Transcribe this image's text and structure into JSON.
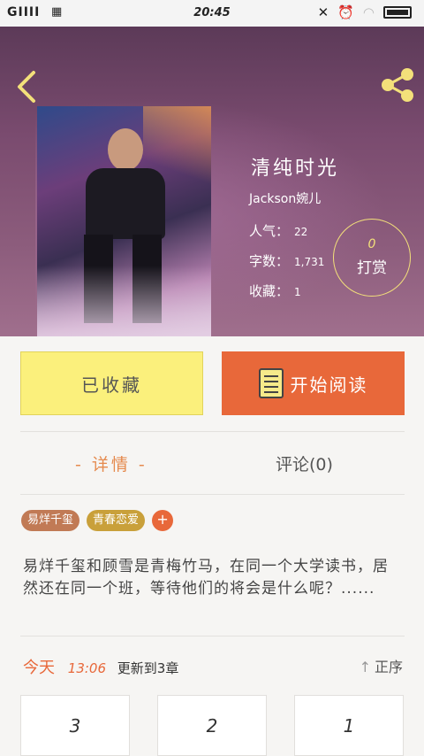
{
  "status_bar": {
    "signal": "GIIII",
    "time": "20:45"
  },
  "book": {
    "title": "清纯时光",
    "author": "Jackson婉儿",
    "stats": [
      {
        "label": "人气：",
        "value": "22"
      },
      {
        "label": "字数：",
        "value": "1,731"
      },
      {
        "label": "收藏：",
        "value": "1"
      }
    ],
    "tip": {
      "count": "0",
      "label": "打赏"
    }
  },
  "actions": {
    "favorite_label": "已收藏",
    "read_label": "开始阅读"
  },
  "tabs": {
    "detail": "- 详情 -",
    "comment": "评论(0)"
  },
  "tags": [
    "易烊千玺",
    "青春恋爱"
  ],
  "tag_add": "+",
  "description": "易烊千玺和顾雪是青梅竹马，在同一个大学读书，居然还在同一个班，等待他们的将会是什么呢？......",
  "update": {
    "today": "今天",
    "time": "13:06",
    "text": "更新到3章",
    "sort_label": "正序"
  },
  "chapters": [
    "3",
    "2",
    "1"
  ],
  "colors": {
    "accent_orange": "#e8683a",
    "accent_yellow": "#fbf07c",
    "icon_yellow": "#f3e07a"
  },
  "icons": {
    "back": "back-arrow-icon",
    "share": "share-icon",
    "book": "book-icon"
  }
}
